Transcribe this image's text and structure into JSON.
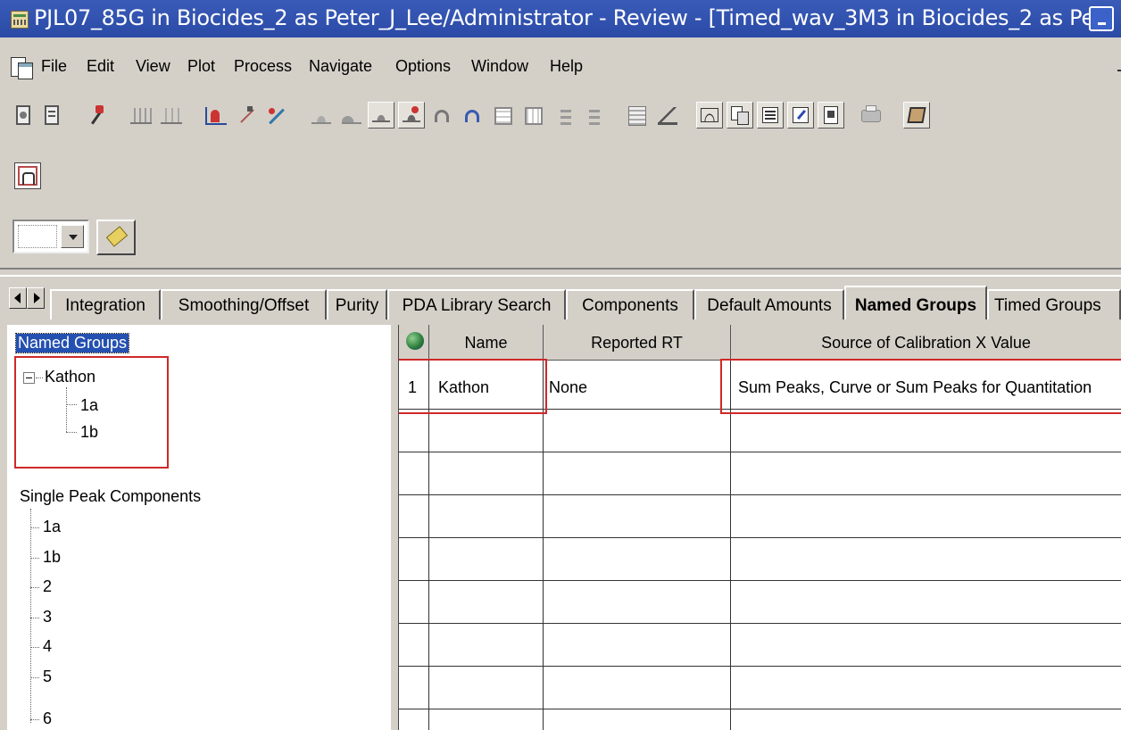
{
  "window": {
    "title": "PJL07_85G in Biocides_2 as Peter_J_Lee/Administrator - Review - [Timed_wav_3M3 in Biocides_2 as Pe..."
  },
  "menu": {
    "items": [
      "File",
      "Edit",
      "View",
      "Plot",
      "Process",
      "Navigate",
      "Options",
      "Window",
      "Help"
    ]
  },
  "toolbar": {
    "icons": [
      "doc-gear-icon",
      "doc-list-icon",
      "wand-icon",
      "peaks-icon",
      "peaks-edit-icon",
      "integrate-icon",
      "manual-peak-icon",
      "calibrate-icon",
      "chrom-a-icon",
      "chrom-b-icon",
      "chrom-c-icon",
      "chrom-d-icon",
      "undo-icon",
      "redo-icon",
      "table-a-icon",
      "table-b-icon",
      "sort-a-icon",
      "sort-b-icon",
      "export-icon",
      "report-icon",
      "spectrum-icon",
      "copy-icon",
      "list-icon",
      "edit-icon",
      "clipboard-icon",
      "print-icon",
      "book-icon"
    ]
  },
  "tabs": [
    "Integration",
    "Smoothing/Offset",
    "Purity",
    "PDA Library Search",
    "Components",
    "Default Amounts",
    "Named Groups",
    "Timed Groups"
  ],
  "active_tab": "Named Groups",
  "tree": {
    "named_groups_label": "Named Groups",
    "group_name": "Kathon",
    "group_children": [
      "1a",
      "1b"
    ],
    "single_label": "Single Peak Components",
    "single_items": [
      "1a",
      "1b",
      "2",
      "3",
      "4",
      "5",
      "6"
    ]
  },
  "grid": {
    "headers": {
      "name": "Name",
      "reported_rt": "Reported RT",
      "source": "Source of Calibration X Value"
    },
    "rows": [
      {
        "num": "1",
        "name": "Kathon",
        "reported_rt": "None",
        "source": "Sum Peaks, Curve or Sum Peaks for Quantitation"
      }
    ]
  },
  "colors": {
    "titlebar": "#2a4aa6",
    "selection": "#2450b0",
    "highlight_box": "#d02828"
  }
}
